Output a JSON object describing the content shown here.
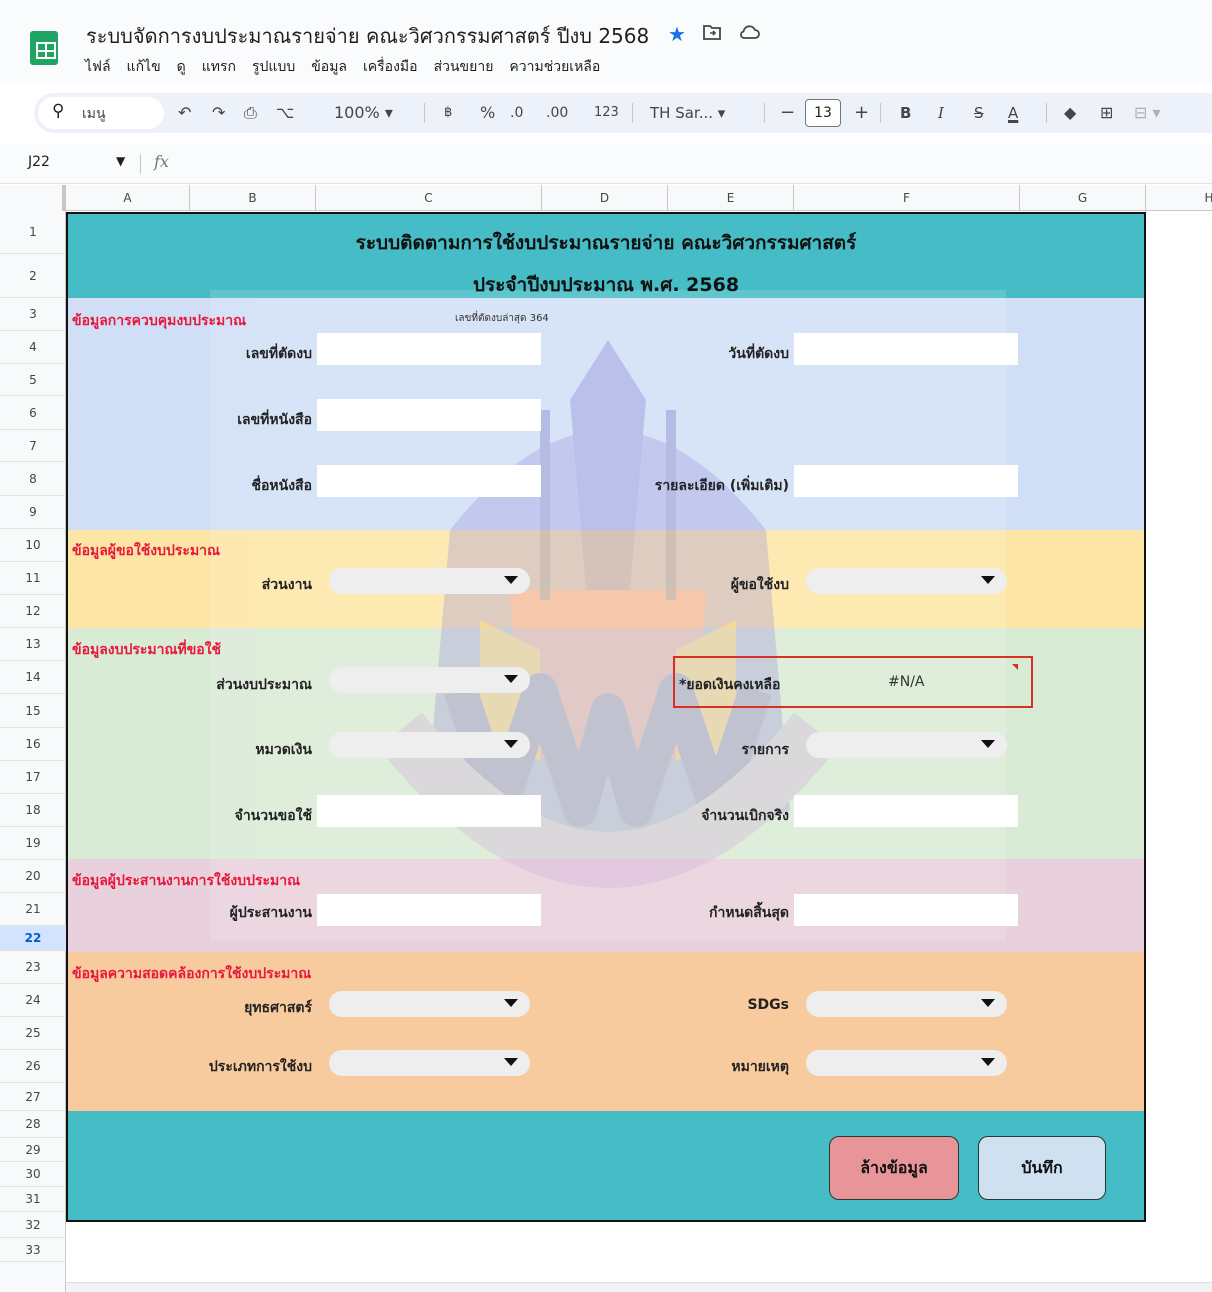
{
  "doc": {
    "title": "ระบบจัดการงบประมาณรายจ่าย คณะวิศวกรรมศาสตร์ ปีงบ 2568",
    "menus": [
      "ไฟล์",
      "แก้ไข",
      "ดู",
      "แทรก",
      "รูปแบบ",
      "ข้อมูล",
      "เครื่องมือ",
      "ส่วนขยาย",
      "ความช่วยเหลือ"
    ]
  },
  "toolbar": {
    "search": "เมนู",
    "zoom": "100%",
    "currency": "฿",
    "percent": "%",
    "dec_decrease": ".0",
    "dec_increase": ".00",
    "number_format": "123",
    "font": "TH Sar...",
    "font_size": "13",
    "minus": "−",
    "plus": "+",
    "bold": "B",
    "italic": "I",
    "strike": "S",
    "textcolor": "A"
  },
  "formula_bar": {
    "cell": "J22",
    "fx": "fx"
  },
  "columns": [
    "A",
    "B",
    "C",
    "D",
    "E",
    "F",
    "G",
    "H"
  ],
  "rows": [
    "1",
    "2",
    "3",
    "4",
    "5",
    "6",
    "7",
    "8",
    "9",
    "10",
    "11",
    "12",
    "13",
    "14",
    "15",
    "16",
    "17",
    "18",
    "19",
    "20",
    "21",
    "22",
    "23",
    "24",
    "25",
    "26",
    "27",
    "28",
    "29",
    "30",
    "31",
    "32",
    "33"
  ],
  "selected_row": "22",
  "form": {
    "title_line1": "ระบบติดตามการใช้งบประมาณรายจ่าย คณะวิศวกรรมศาสตร์",
    "title_line2": "ประจำปีงบประมาณ พ.ศ. 2568",
    "section_budget_control": "ข้อมูลการควบคุมงบประมาณ",
    "last_number_note": "เลขที่ตัดงบล่าสุด  364",
    "label_cut_number": "เลขที่ตัดงบ",
    "label_cut_date": "วันที่ตัดงบ",
    "label_letter_number": "เลขที่หนังสือ",
    "label_letter_name": "ชื่อหนังสือ",
    "label_details": "รายละเอียด (เพิ่มเติม)",
    "section_requester": "ข้อมูลผู้ขอใช้งบประมาณ",
    "label_unit": "ส่วนงาน",
    "label_requester": "ผู้ขอใช้งบ",
    "section_budget_request": "ข้อมูลงบประมาณที่ขอใช้",
    "label_budget_part": "ส่วนงบประมาณ",
    "label_balance": "*ยอดเงินคงเหลือ",
    "balance_value": "#N/A",
    "label_money_category": "หมวดเงิน",
    "label_item": "รายการ",
    "label_request_amount": "จำนวนขอใช้",
    "label_actual_amount": "จำนวนเบิกจริง",
    "section_coordinator": "ข้อมูลผู้ประสานงานการใช้งบประมาณ",
    "label_coordinator": "ผู้ประสานงาน",
    "label_deadline": "กำหนดสิ้นสุด",
    "section_alignment": "ข้อมูลความสอดคล้องการใช้งบประมาณ",
    "label_strategy": "ยุทธศาสตร์",
    "label_sdgs": "SDGs",
    "label_usage_type": "ประเภทการใช้งบ",
    "label_note": "หมายเหตุ",
    "btn_clear": "ล้างข้อมูล",
    "btn_save": "บันทึก"
  },
  "colors": {
    "header_teal": "#45bcc6",
    "section_blue": "#d0dff6",
    "section_yellow": "#fde5a5",
    "section_green": "#d9ead5",
    "section_pink": "#e8d0dc",
    "section_orange": "#f8cb9f",
    "label_red": "#e8173c",
    "button_clear": "#e8959a",
    "button_save": "#cfe0f1"
  }
}
